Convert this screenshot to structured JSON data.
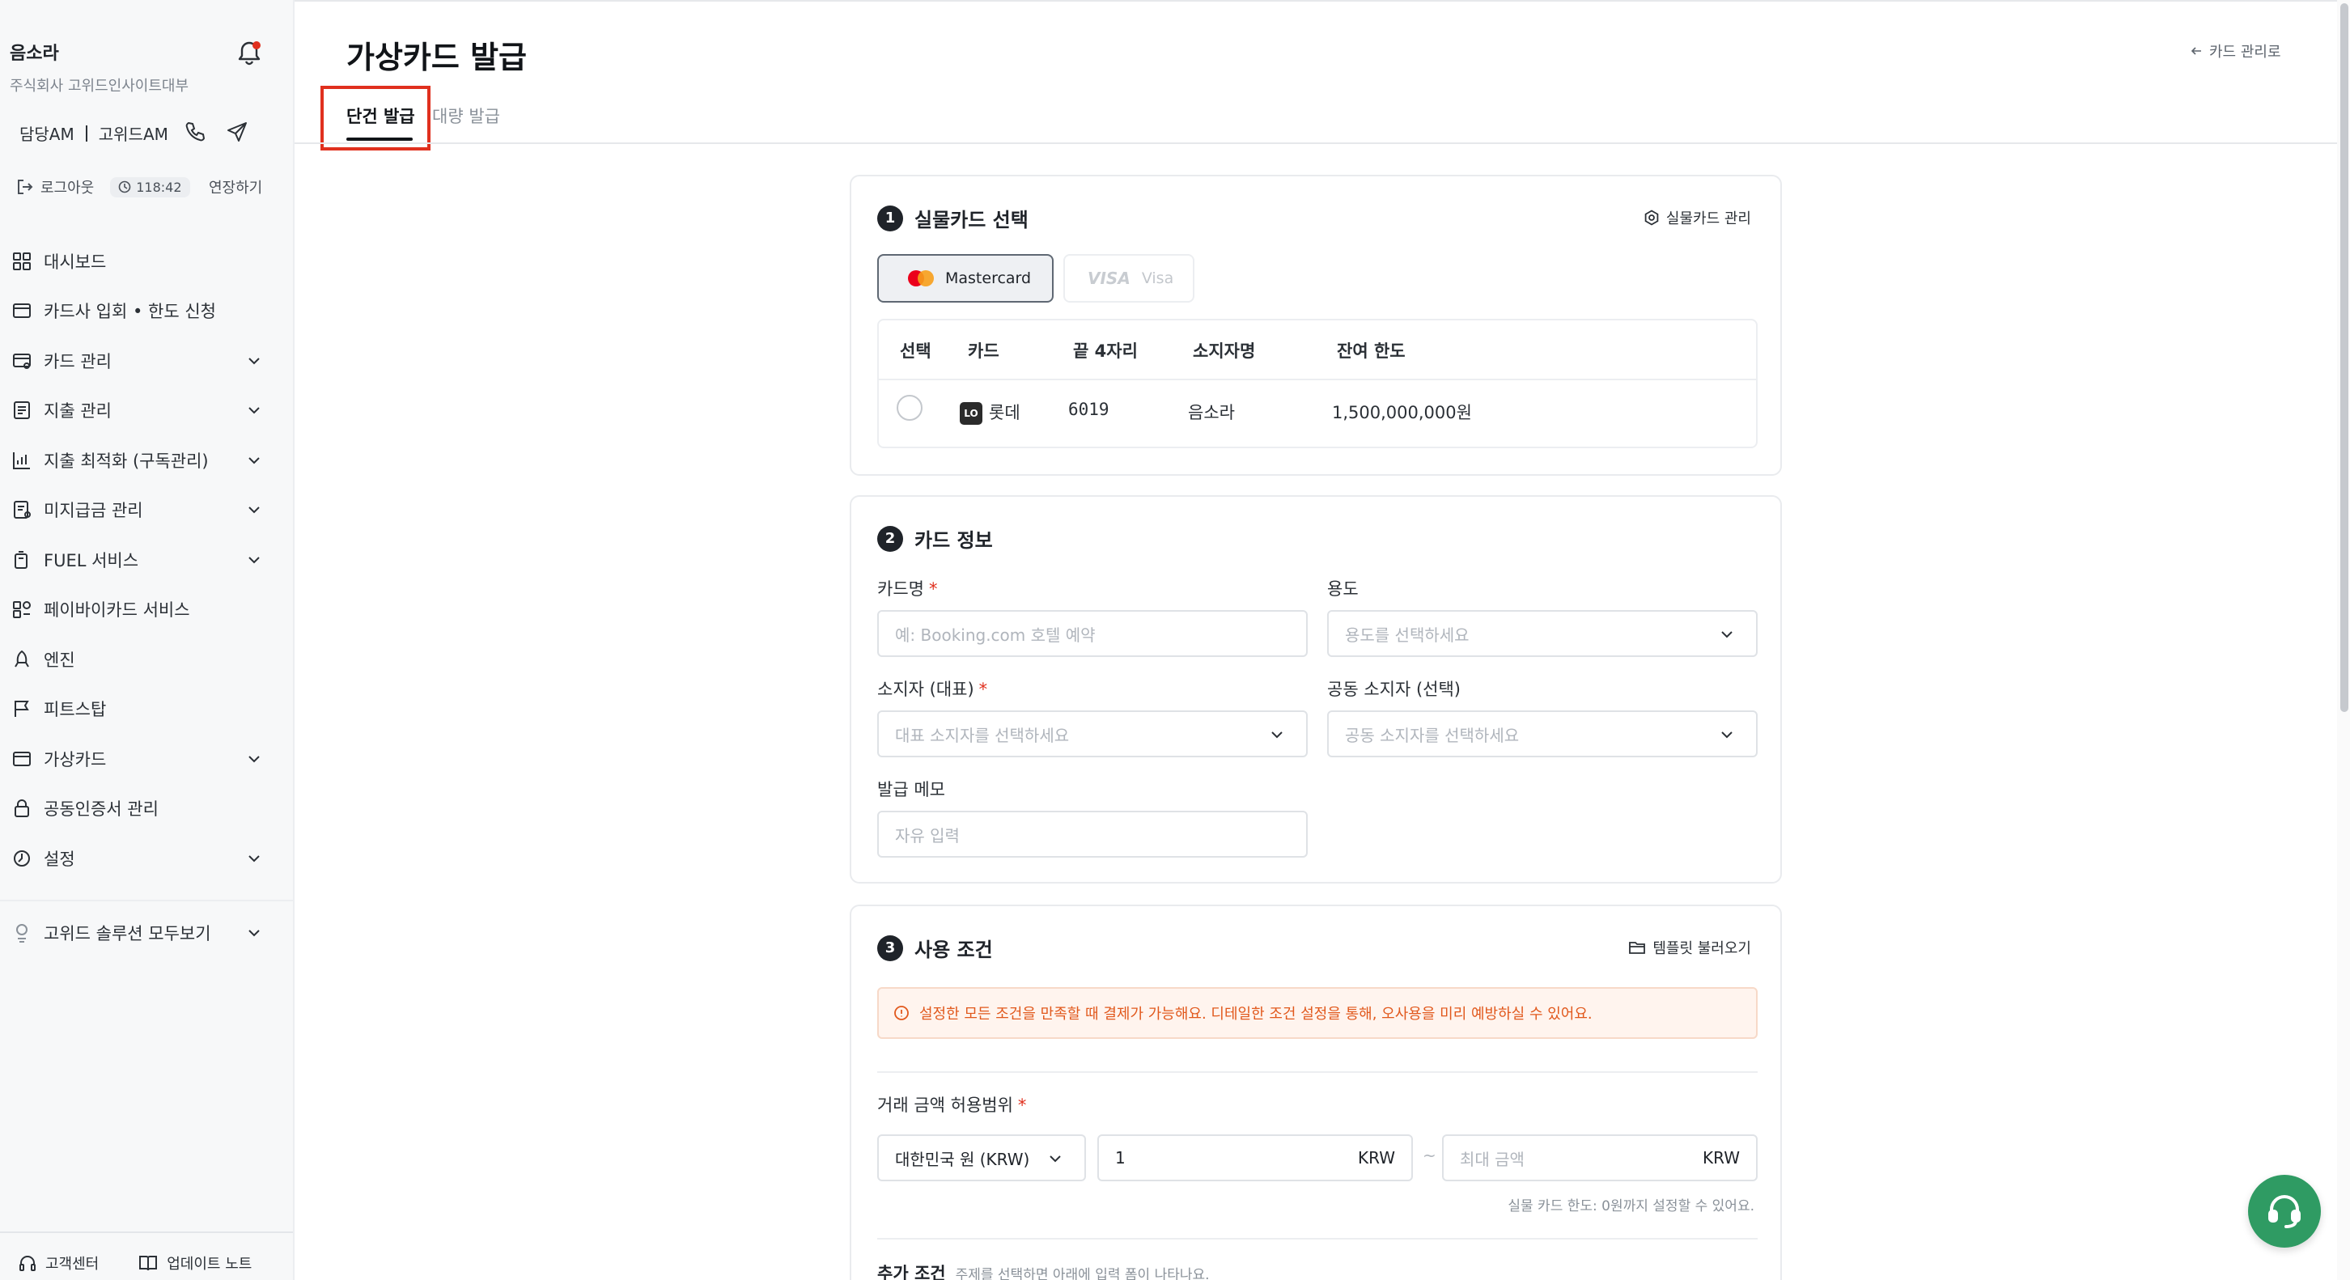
{
  "user": {
    "name": "음소라",
    "company": "주식회사 고위드인사이트대부",
    "am": "담당AM",
    "am_name": "고위드AM",
    "logout": "로그아웃",
    "timer": "118:42",
    "extend": "연장하기"
  },
  "sidebar": {
    "items": [
      {
        "label": "대시보드",
        "icon": "grid-icon",
        "expandable": false
      },
      {
        "label": "카드사 입회 • 한도 신청",
        "icon": "card-icon",
        "expandable": false
      },
      {
        "label": "카드 관리",
        "icon": "card-settings-icon",
        "expandable": true
      },
      {
        "label": "지출 관리",
        "icon": "document-icon",
        "expandable": true
      },
      {
        "label": "지출 최적화 (구독관리)",
        "icon": "chart-icon",
        "expandable": true
      },
      {
        "label": "미지급금 관리",
        "icon": "invoice-icon",
        "expandable": true
      },
      {
        "label": "FUEL 서비스",
        "icon": "fuel-icon",
        "expandable": true
      },
      {
        "label": "페이바이카드 서비스",
        "icon": "paybycard-icon",
        "expandable": false
      },
      {
        "label": "엔진",
        "icon": "rocket-icon",
        "expandable": false
      },
      {
        "label": "피트스탑",
        "icon": "flag-icon",
        "expandable": false
      },
      {
        "label": "가상카드",
        "icon": "virtual-card-icon",
        "expandable": true
      },
      {
        "label": "공동인증서 관리",
        "icon": "lock-icon",
        "expandable": false
      },
      {
        "label": "설정",
        "icon": "settings-icon",
        "expandable": true
      }
    ],
    "solutions": "고위드 솔루션 모두보기",
    "support": "고객센터",
    "update_notes": "업데이트 노트"
  },
  "page": {
    "title": "가상카드 발급",
    "back_link": "카드 관리로",
    "tabs": [
      {
        "label": "단건 발급",
        "active": true
      },
      {
        "label": "대량 발급",
        "active": false
      }
    ]
  },
  "section1": {
    "number": "1",
    "title": "실물카드 선택",
    "action": "실물카드 관리",
    "brands": [
      {
        "label": "Mastercard",
        "selected": true
      },
      {
        "label": "Visa",
        "logo_text": "VISA",
        "selected": false
      }
    ],
    "table": {
      "headers": [
        "선택",
        "카드",
        "끝 4자리",
        "소지자명",
        "잔여 한도"
      ],
      "rows": [
        {
          "card": "롯데",
          "last4": "6019",
          "holder": "음소라",
          "limit": "1,500,000,000원",
          "selected": false
        }
      ]
    }
  },
  "section2": {
    "number": "2",
    "title": "카드 정보",
    "card_name_label": "카드명",
    "card_name_placeholder": "예: Booking.com 호텔 예약",
    "purpose_label": "용도",
    "purpose_placeholder": "용도를 선택하세요",
    "holder_label": "소지자 (대표)",
    "holder_placeholder": "대표 소지자를 선택하세요",
    "coholder_label": "공동 소지자 (선택)",
    "coholder_placeholder": "공동 소지자를 선택하세요",
    "memo_label": "발급 메모",
    "memo_placeholder": "자유 입력"
  },
  "section3": {
    "number": "3",
    "title": "사용 조건",
    "action": "템플릿 불러오기",
    "notice": "설정한 모든 조건을 만족할 때 결제가 가능해요. 디테일한 조건 설정을 통해, 오사용을 미리 예방하실 수 있어요.",
    "amount_label": "거래 금액 허용범위",
    "currency": "대한민국 원 (KRW)",
    "min_value": "1",
    "unit": "KRW",
    "range_sep": "~",
    "max_placeholder": "최대 금액",
    "hint": "실물 카드 한도: 0원까지 설정할 수 있어요.",
    "extra_label": "추가 조건",
    "extra_hint": "주제를 선택하면 아래에 입력 폼이 나타나요."
  },
  "colors": {
    "accent": "#1f2329",
    "highlight": "#e0301e",
    "notice": "#e1581c",
    "chat": "#2f9b63"
  }
}
